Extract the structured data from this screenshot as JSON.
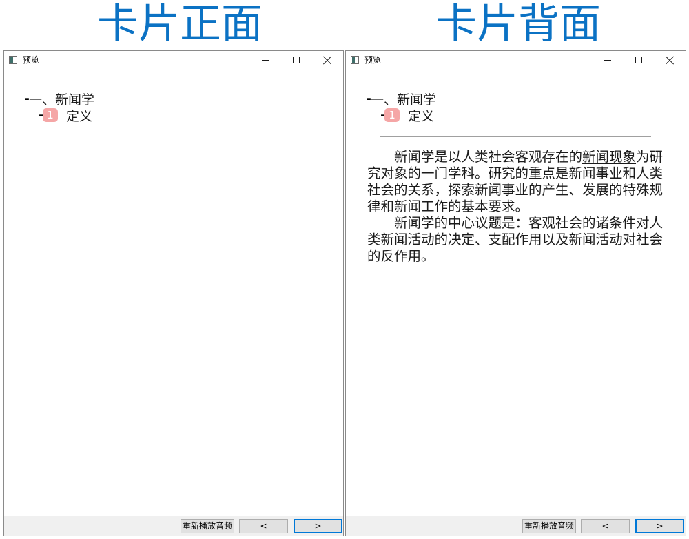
{
  "page_titles": {
    "front": "卡片正面",
    "back": "卡片背面"
  },
  "icons": {
    "app": "window-icon",
    "minimize": "minimize-icon",
    "maximize": "maximize-icon",
    "close": "close-icon"
  },
  "windows": [
    {
      "title": "预览",
      "outline": [
        {
          "marker": "-",
          "label": "一、新闻学"
        },
        {
          "marker": "-",
          "badge": "1",
          "label": "定义"
        }
      ],
      "buttons": {
        "replay": "重新播放音频",
        "prev": "<",
        "next": ">"
      }
    },
    {
      "title": "预览",
      "outline": [
        {
          "marker": "-",
          "label": "一、新闻学"
        },
        {
          "marker": "-",
          "badge": "1",
          "label": "定义"
        }
      ],
      "answer": {
        "paragraphs": [
          {
            "before": "新闻学是以人类社会客观存在的",
            "term": "新闻现象",
            "after": "为研究对象的一门学科。研究的重点是新闻事业和人类社会的关系，探索新闻事业的产生、发展的特殊规律和新闻工作的基本要求。"
          },
          {
            "before": "新闻学的",
            "term": "中心议题",
            "after": "是：客观社会的诸条件对人类新闻活动的决定、支配作用以及新闻活动对社会的反作用。"
          }
        ]
      },
      "buttons": {
        "replay": "重新播放音频",
        "prev": "<",
        "next": ">"
      }
    }
  ],
  "colors": {
    "title": "#0b72c4",
    "badge": "#f5a6a6",
    "focus_border": "#0078d7",
    "bottom_bar": "#f0f0f0"
  }
}
